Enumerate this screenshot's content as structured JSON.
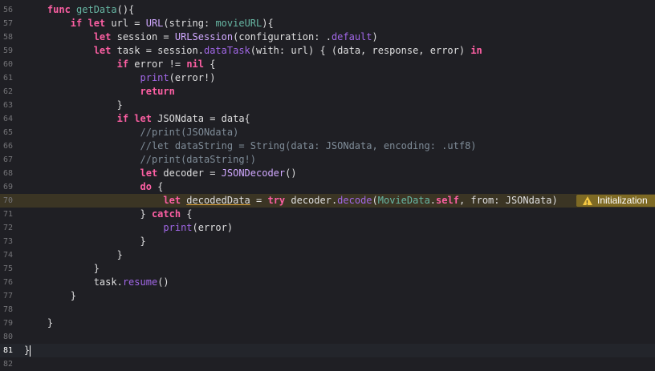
{
  "editor": {
    "lines": [
      {
        "n": "56",
        "segs": [
          {
            "t": "    "
          },
          {
            "t": "func ",
            "c": "kw"
          },
          {
            "t": "getData",
            "c": "fn"
          },
          {
            "t": "(){"
          }
        ]
      },
      {
        "n": "57",
        "segs": [
          {
            "t": "        "
          },
          {
            "t": "if let ",
            "c": "kw"
          },
          {
            "t": "url = "
          },
          {
            "t": "URL",
            "c": "ty2"
          },
          {
            "t": "(string: "
          },
          {
            "t": "movieURL",
            "c": "fn"
          },
          {
            "t": "){"
          }
        ]
      },
      {
        "n": "58",
        "segs": [
          {
            "t": "            "
          },
          {
            "t": "let ",
            "c": "kw"
          },
          {
            "t": "session = "
          },
          {
            "t": "URLSession",
            "c": "ty2"
          },
          {
            "t": "(configuration: ."
          },
          {
            "t": "default",
            "c": "prop"
          },
          {
            "t": ")"
          }
        ]
      },
      {
        "n": "59",
        "segs": [
          {
            "t": "            "
          },
          {
            "t": "let ",
            "c": "kw"
          },
          {
            "t": "task = session."
          },
          {
            "t": "dataTask",
            "c": "prop"
          },
          {
            "t": "(with: url) { (data, response, error) "
          },
          {
            "t": "in",
            "c": "kw"
          }
        ]
      },
      {
        "n": "60",
        "segs": [
          {
            "t": "                "
          },
          {
            "t": "if ",
            "c": "kw"
          },
          {
            "t": "error "
          },
          {
            "t": "!= ",
            "c": "pl"
          },
          {
            "t": "nil",
            "c": "kw"
          },
          {
            "t": " {"
          }
        ]
      },
      {
        "n": "61",
        "segs": [
          {
            "t": "                    "
          },
          {
            "t": "print",
            "c": "prop"
          },
          {
            "t": "(error!)"
          }
        ]
      },
      {
        "n": "62",
        "segs": [
          {
            "t": "                    "
          },
          {
            "t": "return",
            "c": "kw"
          }
        ]
      },
      {
        "n": "63",
        "segs": [
          {
            "t": "                }"
          }
        ]
      },
      {
        "n": "64",
        "segs": [
          {
            "t": "                "
          },
          {
            "t": "if let ",
            "c": "kw"
          },
          {
            "t": "JSONdata = data{"
          }
        ]
      },
      {
        "n": "65",
        "segs": [
          {
            "t": "                    "
          },
          {
            "t": "//print(JSONdata)",
            "c": "cm"
          }
        ]
      },
      {
        "n": "66",
        "segs": [
          {
            "t": "                    "
          },
          {
            "t": "//let dataString = String(data: JSONdata, encoding: .utf8)",
            "c": "cm"
          }
        ]
      },
      {
        "n": "67",
        "segs": [
          {
            "t": "                    "
          },
          {
            "t": "//print(dataString!)",
            "c": "cm"
          }
        ]
      },
      {
        "n": "68",
        "segs": [
          {
            "t": "                    "
          },
          {
            "t": "let ",
            "c": "kw"
          },
          {
            "t": "decoder = "
          },
          {
            "t": "JSONDecoder",
            "c": "ty2"
          },
          {
            "t": "()"
          }
        ]
      },
      {
        "n": "69",
        "segs": [
          {
            "t": "                    "
          },
          {
            "t": "do",
            "c": "kw"
          },
          {
            "t": " {"
          }
        ]
      },
      {
        "n": "70",
        "segs": [
          {
            "t": "                        "
          },
          {
            "t": "let ",
            "c": "kw"
          },
          {
            "t": "decodedData",
            "c": "underline"
          },
          {
            "t": " = "
          },
          {
            "t": "try ",
            "c": "kw"
          },
          {
            "t": "decoder."
          },
          {
            "t": "decode",
            "c": "prop"
          },
          {
            "t": "("
          },
          {
            "t": "MovieData",
            "c": "fn"
          },
          {
            "t": "."
          },
          {
            "t": "self",
            "c": "kw"
          },
          {
            "t": ", from: JSONdata)"
          }
        ],
        "warn": true
      },
      {
        "n": "71",
        "segs": [
          {
            "t": "                    } "
          },
          {
            "t": "catch",
            "c": "kw"
          },
          {
            "t": " {"
          }
        ]
      },
      {
        "n": "72",
        "segs": [
          {
            "t": "                        "
          },
          {
            "t": "print",
            "c": "prop"
          },
          {
            "t": "(error)"
          }
        ]
      },
      {
        "n": "73",
        "segs": [
          {
            "t": "                    }"
          }
        ]
      },
      {
        "n": "74",
        "segs": [
          {
            "t": "                }"
          }
        ]
      },
      {
        "n": "75",
        "segs": [
          {
            "t": "            }"
          }
        ]
      },
      {
        "n": "76",
        "segs": [
          {
            "t": "            task."
          },
          {
            "t": "resume",
            "c": "prop"
          },
          {
            "t": "()"
          }
        ]
      },
      {
        "n": "77",
        "segs": [
          {
            "t": "        }"
          }
        ]
      },
      {
        "n": "78",
        "segs": []
      },
      {
        "n": "79",
        "segs": [
          {
            "t": "    }"
          }
        ]
      },
      {
        "n": "80",
        "segs": []
      },
      {
        "n": "81",
        "segs": [
          {
            "t": "}"
          }
        ],
        "current": true
      },
      {
        "n": "82",
        "segs": []
      }
    ],
    "warning": {
      "icon": "warning-triangle-icon",
      "text": "Initialization"
    }
  }
}
